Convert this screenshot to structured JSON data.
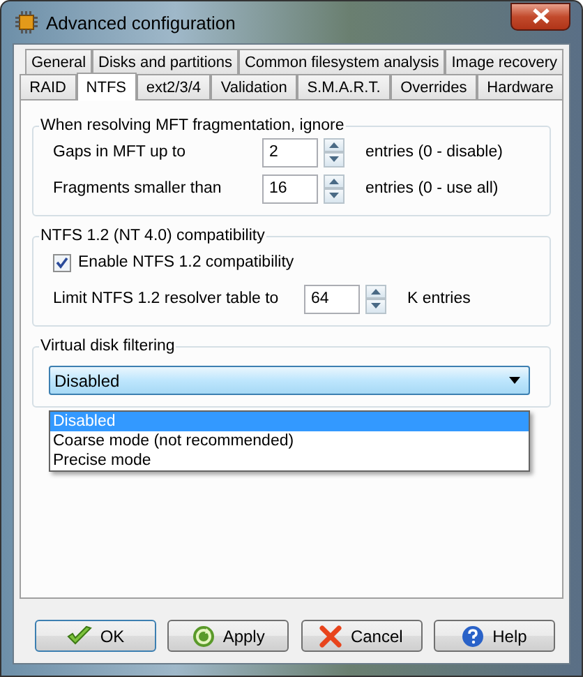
{
  "window": {
    "title": "Advanced configuration"
  },
  "tab_rows": [
    [
      {
        "label": "General",
        "selected": false
      },
      {
        "label": "Disks and partitions",
        "selected": false
      },
      {
        "label": "Common filesystem analysis",
        "selected": false
      },
      {
        "label": "Image recovery",
        "selected": false
      }
    ],
    [
      {
        "label": "RAID",
        "selected": false
      },
      {
        "label": "NTFS",
        "selected": true
      },
      {
        "label": "ext2/3/4",
        "selected": false
      },
      {
        "label": "Validation",
        "selected": false
      },
      {
        "label": "S.M.A.R.T.",
        "selected": false
      },
      {
        "label": "Overrides",
        "selected": false
      },
      {
        "label": "Hardware",
        "selected": false
      }
    ]
  ],
  "groups": [
    {
      "title": "When resolving MFT fragmentation, ignore",
      "rows": [
        {
          "kind": "spin",
          "label": "Gaps in MFT up to",
          "value": "2",
          "unit": "entries (0 - disable)"
        },
        {
          "kind": "spin",
          "label": "Fragments smaller than",
          "value": "16",
          "unit": "entries (0 - use all)"
        }
      ]
    },
    {
      "title": "NTFS 1.2 (NT 4.0) compatibility",
      "rows": [
        {
          "kind": "check",
          "label": "Enable NTFS 1.2 compatibility",
          "checked": true
        },
        {
          "kind": "spin",
          "label": "Limit NTFS 1.2 resolver table to",
          "value": "64",
          "unit": "K entries"
        }
      ]
    },
    {
      "title": "Virtual disk filtering",
      "rows": [
        {
          "kind": "combo",
          "value": "Disabled",
          "expanded": true,
          "options": [
            {
              "label": "Disabled",
              "selected": true
            },
            {
              "label": "Coarse mode (not recommended)",
              "selected": false
            },
            {
              "label": "Precise mode",
              "selected": false
            }
          ]
        }
      ]
    }
  ],
  "buttons": [
    {
      "kind": "ok",
      "label": "OK"
    },
    {
      "kind": "apply",
      "label": "Apply"
    },
    {
      "kind": "cancel",
      "label": "Cancel"
    },
    {
      "kind": "help",
      "label": "Help"
    }
  ]
}
